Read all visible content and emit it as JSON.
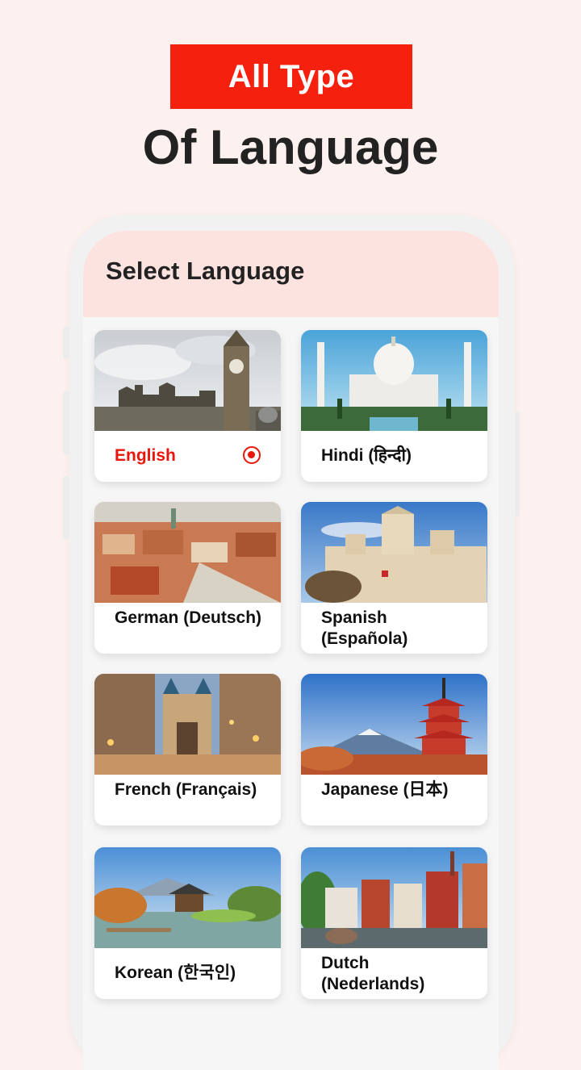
{
  "promo": {
    "badge": "All Type",
    "title": "Of Language"
  },
  "app": {
    "title": "Select Language"
  },
  "languages": [
    {
      "label": "English",
      "selected": true,
      "image": "big-ben-london"
    },
    {
      "label": "Hindi (हिन्दी)",
      "selected": false,
      "image": "taj-mahal"
    },
    {
      "label": "German (Deutsch)",
      "selected": false,
      "image": "german-city-aerial"
    },
    {
      "label": "Spanish (Española)",
      "selected": false,
      "image": "madrid-palace"
    },
    {
      "label": "French (Français)",
      "selected": false,
      "image": "bordeaux-gate"
    },
    {
      "label": "Japanese (日本)",
      "selected": false,
      "image": "mount-fuji-pagoda"
    },
    {
      "label": "Korean (한국인)",
      "selected": false,
      "image": "korean-pavilion"
    },
    {
      "label": "Dutch (Nederlands)",
      "selected": false,
      "image": "dutch-canal-houses"
    }
  ],
  "colors": {
    "accent": "#f5200e",
    "selected_text": "#e8160b",
    "header_bg": "#fde3e0"
  }
}
